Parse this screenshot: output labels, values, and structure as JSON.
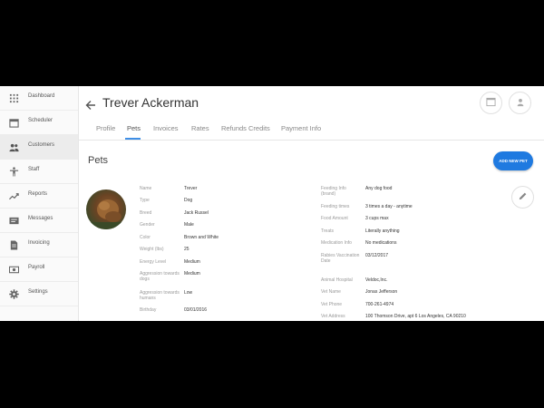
{
  "sidebar": {
    "items": [
      {
        "label": "Dashboard",
        "icon": "grid-icon",
        "active": false
      },
      {
        "label": "Scheduler",
        "icon": "calendar-icon",
        "active": false
      },
      {
        "label": "Customers",
        "icon": "people-icon",
        "active": true
      },
      {
        "label": "Staff",
        "icon": "person-icon",
        "active": false
      },
      {
        "label": "Reports",
        "icon": "trend-icon",
        "active": false
      },
      {
        "label": "Messages",
        "icon": "message-icon",
        "active": false
      },
      {
        "label": "Invoicing",
        "icon": "document-icon",
        "active": false
      },
      {
        "label": "Payroll",
        "icon": "money-icon",
        "active": false
      },
      {
        "label": "Settings",
        "icon": "gear-icon",
        "active": false
      }
    ]
  },
  "header": {
    "title": "Trever Ackerman"
  },
  "tabs": [
    {
      "label": "Profile",
      "active": false
    },
    {
      "label": "Pets",
      "active": true
    },
    {
      "label": "Invoices",
      "active": false
    },
    {
      "label": "Rates",
      "active": false
    },
    {
      "label": "Refunds Credits",
      "active": false
    },
    {
      "label": "Payment Info",
      "active": false
    }
  ],
  "pets": {
    "section_title": "Pets",
    "add_button": "ADD NEW PET",
    "left": [
      {
        "key": "Name",
        "value": "Trever"
      },
      {
        "key": "Type",
        "value": "Dog"
      },
      {
        "key": "Breed",
        "value": "Jack Russel"
      },
      {
        "key": "Gender",
        "value": "Male"
      },
      {
        "key": "Color",
        "value": "Brown and White"
      },
      {
        "key": "Weight (lbs)",
        "value": "25"
      },
      {
        "key": "Energy Level",
        "value": "Medium"
      },
      {
        "key": "Aggression towards dogs",
        "value": "Medium"
      },
      {
        "key": "Aggression towards humans",
        "value": "Low"
      },
      {
        "key": "Birthday",
        "value": "03/01/2016"
      }
    ],
    "right": [
      {
        "key": "Feeding Info (brand)",
        "value": "Any dog food"
      },
      {
        "key": "Feeding times",
        "value": "3 times a day - anytime"
      },
      {
        "key": "Food Amount",
        "value": "3 cups max"
      },
      {
        "key": "Treats",
        "value": "Literally anything"
      },
      {
        "key": "Medication Info",
        "value": "No medications"
      },
      {
        "key": "Rabies Vaccination Date",
        "value": "03/12/2017"
      },
      {
        "key": "Animal Hospital",
        "value": "Veldoc,Inc."
      },
      {
        "key": "Vet Name",
        "value": "Jonas Jefferson"
      },
      {
        "key": "Vet Phone",
        "value": "700-261-4974"
      },
      {
        "key": "Vet Address",
        "value": "100 Thomson Drive, apt 6 Los Angeles, CA 90210"
      }
    ]
  },
  "colors": {
    "accent": "#1f7ae0",
    "tab_underline": "#3f8fe6"
  }
}
